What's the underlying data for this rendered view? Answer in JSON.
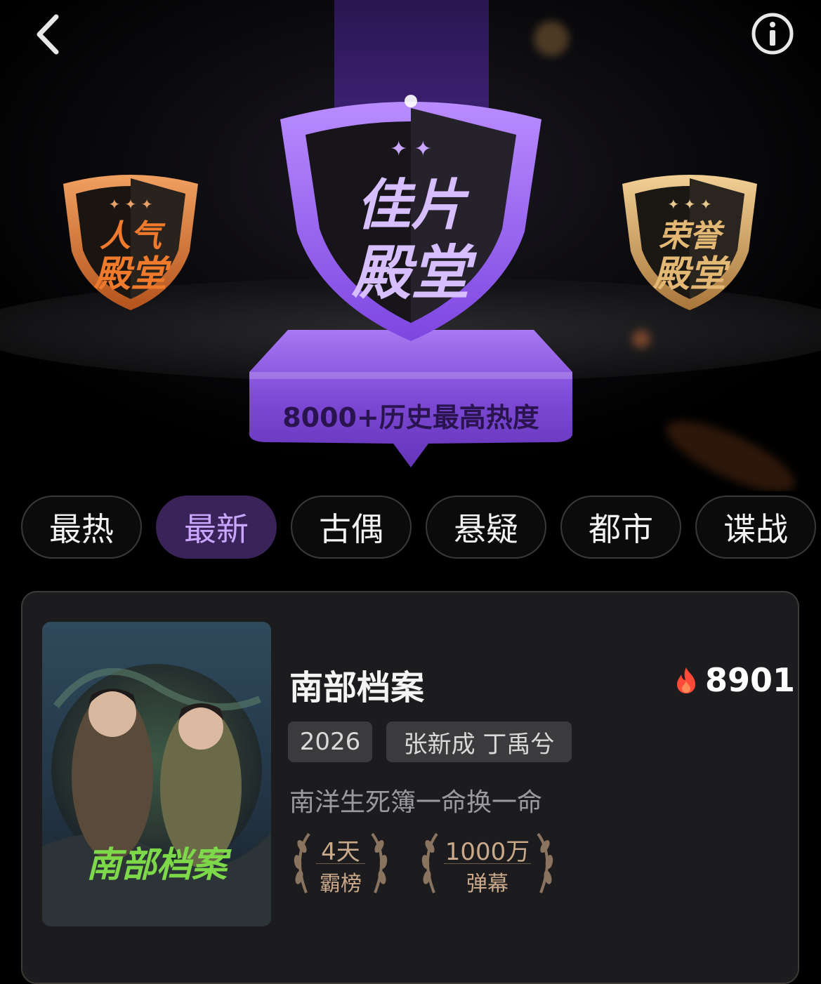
{
  "hero": {
    "center_badge": {
      "line1": "佳片",
      "line2": "殿堂"
    },
    "left_badge": {
      "line1": "人气",
      "line2": "殿堂"
    },
    "right_badge": {
      "line1": "荣誉",
      "line2": "殿堂"
    },
    "pedestal_label": "8000+历史最高热度"
  },
  "icons": {
    "back": "chevron-left-icon",
    "info": "info-icon"
  },
  "tabs": [
    {
      "label": "最热"
    },
    {
      "label": "最新",
      "active": true
    },
    {
      "label": "古偶"
    },
    {
      "label": "悬疑"
    },
    {
      "label": "都市"
    },
    {
      "label": "谍战"
    }
  ],
  "card": {
    "poster_title": "南部档案",
    "title": "南部档案",
    "heat": "8901",
    "year": "2026",
    "cast": "张新成 丁禹兮",
    "description": "南洋生死簿一命换一命",
    "awards": [
      {
        "top": "4天",
        "bottom": "霸榜"
      },
      {
        "top": "1000万",
        "bottom": "弹幕"
      }
    ]
  },
  "colors": {
    "accent_purple": "#8c5cf0",
    "active_tab_bg": "#3a2358",
    "active_tab_text": "#c9a6ff",
    "award_gold": "#c9a98a"
  }
}
